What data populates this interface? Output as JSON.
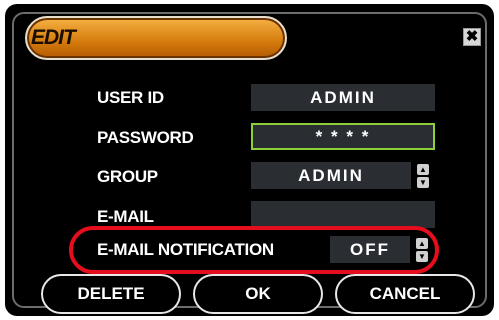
{
  "dialog": {
    "title": "EDIT",
    "close_glyph": "✖"
  },
  "form": {
    "user_id_label": "USER ID",
    "user_id_value": "ADMIN",
    "password_label": "PASSWORD",
    "password_value": "* * * *",
    "group_label": "GROUP",
    "group_value": "ADMIN",
    "email_label": "E-MAIL",
    "email_value": "",
    "email_notification_label": "E-MAIL NOTIFICATION",
    "email_notification_value": "OFF"
  },
  "buttons": {
    "delete": "DELETE",
    "ok": "OK",
    "cancel": "CANCEL"
  },
  "colors": {
    "accent_orange": "#d47a0c",
    "focus_green": "#8ccf3b",
    "highlight_red": "#e60d1c"
  },
  "icons": {
    "spinner_up": "▲",
    "spinner_down": "▼"
  }
}
